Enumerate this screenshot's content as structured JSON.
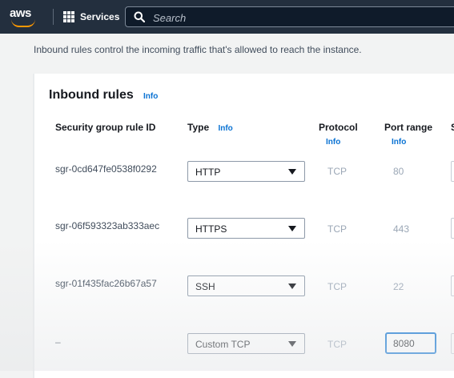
{
  "topbar": {
    "logo_text": "aws",
    "services_label": "Services",
    "search_placeholder": "Search"
  },
  "intro_text": "Inbound rules control the incoming traffic that's allowed to reach the instance.",
  "panel": {
    "title": "Inbound rules",
    "title_info": "Info",
    "columns": {
      "rule_id": "Security group rule ID",
      "type": "Type",
      "type_info": "Info",
      "protocol": "Protocol",
      "protocol_info": "Info",
      "port_range": "Port range",
      "port_range_info": "Info",
      "cutoff": "S"
    },
    "rows": [
      {
        "rule_id": "sgr-0cd647fe0538f0292",
        "type": "HTTP",
        "protocol": "TCP",
        "port": "80"
      },
      {
        "rule_id": "sgr-06f593323ab333aec",
        "type": "HTTPS",
        "protocol": "TCP",
        "port": "443"
      },
      {
        "rule_id": "sgr-01f435fac26b67a57",
        "type": "SSH",
        "protocol": "TCP",
        "port": "22"
      },
      {
        "rule_id": "–",
        "type": "Custom TCP",
        "protocol": "TCP",
        "port": "8080"
      }
    ]
  },
  "colors": {
    "topbar_bg": "#232f3e",
    "accent_orange": "#ff9900",
    "link_blue": "#0972d3"
  }
}
